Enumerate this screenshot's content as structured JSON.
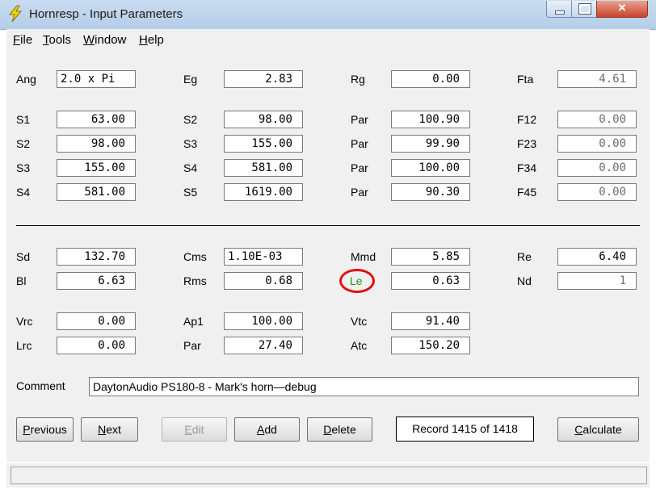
{
  "window": {
    "title": "Hornresp - Input Parameters",
    "accent": "#e01010"
  },
  "menu": [
    {
      "first": "F",
      "rest": "ile"
    },
    {
      "first": "T",
      "rest": "ools"
    },
    {
      "first": "W",
      "rest": "indow"
    },
    {
      "first": "H",
      "rest": "elp"
    }
  ],
  "params": {
    "ang": {
      "label": "Ang",
      "value": "2.0 x Pi"
    },
    "eg": {
      "label": "Eg",
      "value": "2.83"
    },
    "rg": {
      "label": "Rg",
      "value": "0.00"
    },
    "fta": {
      "label": "Fta",
      "value": "4.61"
    },
    "s1a": {
      "label": "S1",
      "value": "63.00"
    },
    "s2b": {
      "label": "S2",
      "value": "98.00"
    },
    "par1": {
      "label": "Par",
      "value": "100.90"
    },
    "f12": {
      "label": "F12",
      "value": "0.00"
    },
    "s2a": {
      "label": "S2",
      "value": "98.00"
    },
    "s3b": {
      "label": "S3",
      "value": "155.00"
    },
    "par2": {
      "label": "Par",
      "value": "99.90"
    },
    "f23": {
      "label": "F23",
      "value": "0.00"
    },
    "s3a": {
      "label": "S3",
      "value": "155.00"
    },
    "s4b": {
      "label": "S4",
      "value": "581.00"
    },
    "par3": {
      "label": "Par",
      "value": "100.00"
    },
    "f34": {
      "label": "F34",
      "value": "0.00"
    },
    "s4a": {
      "label": "S4",
      "value": "581.00"
    },
    "s5b": {
      "label": "S5",
      "value": "1619.00"
    },
    "par4": {
      "label": "Par",
      "value": "90.30"
    },
    "f45": {
      "label": "F45",
      "value": "0.00"
    },
    "sd": {
      "label": "Sd",
      "value": "132.70"
    },
    "cms": {
      "label": "Cms",
      "value": "1.10E-03"
    },
    "mmd": {
      "label": "Mmd",
      "value": "5.85"
    },
    "re": {
      "label": "Re",
      "value": "6.40"
    },
    "bl": {
      "label": "Bl",
      "value": "6.63"
    },
    "rms": {
      "label": "Rms",
      "value": "0.68"
    },
    "le": {
      "label": "Le",
      "value": "0.63"
    },
    "nd": {
      "label": "Nd",
      "value": "1"
    },
    "vrc": {
      "label": "Vrc",
      "value": "0.00"
    },
    "ap1": {
      "label": "Ap1",
      "value": "100.00"
    },
    "vtc": {
      "label": "Vtc",
      "value": "91.40"
    },
    "lrc": {
      "label": "Lrc",
      "value": "0.00"
    },
    "par5": {
      "label": "Par",
      "value": "27.40"
    },
    "atc": {
      "label": "Atc",
      "value": "150.20"
    }
  },
  "comment": {
    "label": "Comment",
    "value": "DaytonAudio PS180-8 - Mark's horn—debug"
  },
  "buttons": {
    "previous": {
      "first": "P",
      "rest": "revious"
    },
    "next": {
      "first": "N",
      "rest": "ext"
    },
    "edit": {
      "first": "E",
      "rest": "dit"
    },
    "add": {
      "first": "A",
      "rest": "dd"
    },
    "delete": {
      "first": "D",
      "rest": "elete"
    },
    "calculate": {
      "first": "C",
      "rest": "alculate"
    }
  },
  "record": "Record 1415 of 1418"
}
